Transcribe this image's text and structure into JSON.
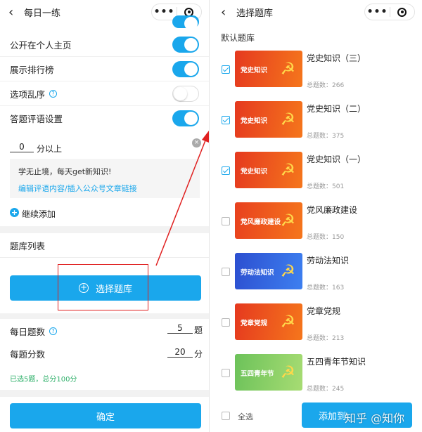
{
  "left": {
    "nav_title": "每日一练",
    "settings": [
      {
        "label": "公开在个人主页",
        "on": true
      },
      {
        "label": "展示排行榜",
        "on": true
      },
      {
        "label": "选项乱序",
        "on": false,
        "help": true
      },
      {
        "label": "答题评语设置",
        "on": true
      }
    ],
    "score_value": "0",
    "score_suffix": "分以上",
    "comment_text": "学无止境，每天get新知识!",
    "comment_link": "编辑评语内容/插入公众号文章链接",
    "add_more": "继续添加",
    "bank_list_title": "题库列表",
    "select_bank_button": "选择题库",
    "daily_count_label": "每日题数",
    "daily_count_value": "5",
    "daily_count_unit": "题",
    "per_score_label": "每题分数",
    "per_score_value": "20",
    "per_score_unit": "分",
    "summary": "已选5题，总分100分",
    "confirm_button": "确定"
  },
  "right": {
    "nav_title": "选择题库",
    "section_title": "默认题库",
    "count_prefix": "总题数：",
    "banks": [
      {
        "thumb_label": "党史知识",
        "title": "党史知识（三）",
        "count": "266",
        "checked": true,
        "color": "#e5391f"
      },
      {
        "thumb_label": "党史知识",
        "title": "党史知识（二）",
        "count": "375",
        "checked": true,
        "color": "#e5391f"
      },
      {
        "thumb_label": "党史知识",
        "title": "党史知识（一）",
        "count": "501",
        "checked": true,
        "color": "#e5391f"
      },
      {
        "thumb_label": "党风廉政建设",
        "title": "党风廉政建设",
        "count": "150",
        "checked": false,
        "color": "#e8401e"
      },
      {
        "thumb_label": "劳动法知识",
        "title": "劳动法知识",
        "count": "163",
        "checked": false,
        "color": "#2c4fd0"
      },
      {
        "thumb_label": "党章党规",
        "title": "党章党规",
        "count": "213",
        "checked": false,
        "color": "#e5391f"
      },
      {
        "thumb_label": "五四青年节",
        "title": "五四青年节知识",
        "count": "245",
        "checked": false,
        "color": "#6cc25a"
      }
    ],
    "select_all": "全选",
    "add_button": "添加到",
    "watermark": "知乎 @知你"
  }
}
